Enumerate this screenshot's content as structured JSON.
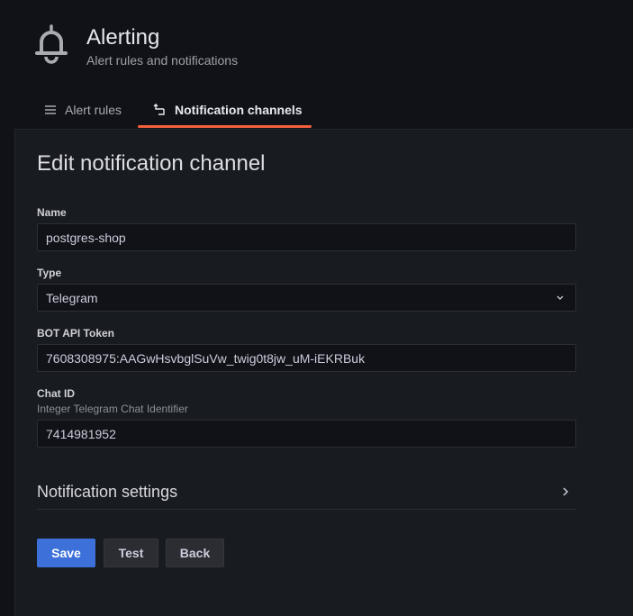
{
  "header": {
    "title": "Alerting",
    "subtitle": "Alert rules and notifications",
    "icon": "bell-icon"
  },
  "tabs": [
    {
      "label": "Alert rules",
      "icon": "list-icon",
      "active": false
    },
    {
      "label": "Notification channels",
      "icon": "channels-icon",
      "active": true
    }
  ],
  "colors": {
    "accent_tab": "#f55f3e",
    "primary_button": "#3d71d9",
    "background": "#111217",
    "panel": "#181b1f"
  },
  "form": {
    "title": "Edit notification channel",
    "name": {
      "label": "Name",
      "value": "postgres-shop"
    },
    "type": {
      "label": "Type",
      "value": "Telegram"
    },
    "bot_token": {
      "label": "BOT API Token",
      "value": "7608308975:AAGwHsvbglSuVw_twig0t8jw_uM-iEKRBuk"
    },
    "chat_id": {
      "label": "Chat ID",
      "description": "Integer Telegram Chat Identifier",
      "value": "7414981952"
    },
    "settings_section": "Notification settings"
  },
  "buttons": {
    "save": "Save",
    "test": "Test",
    "back": "Back"
  }
}
